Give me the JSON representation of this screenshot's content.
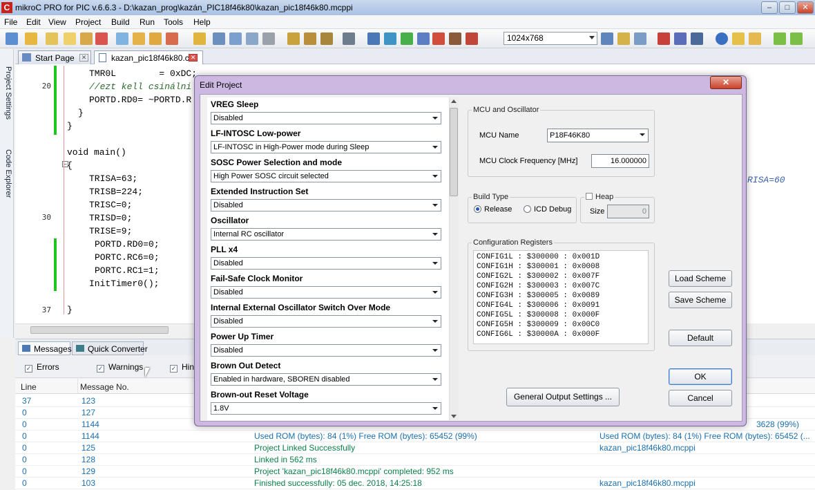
{
  "window": {
    "title": "mikroC PRO for PIC v.6.6.3 - D:\\kazan_prog\\kazán_PIC18f46k80\\kazan_pic18f46k80.mcppi",
    "app_icon": "C"
  },
  "menu": [
    "File",
    "Edit",
    "View",
    "Project",
    "Build",
    "Run",
    "Tools",
    "Help"
  ],
  "toolbar": {
    "resolution": "1024x768"
  },
  "side_tabs": [
    "Project Settings",
    "Code Explorer"
  ],
  "doc_tabs": [
    {
      "label": "Start Page"
    },
    {
      "label": "kazan_pic18f46k80.c"
    }
  ],
  "editor": {
    "line_numbers": [
      "20",
      "30",
      "37"
    ],
    "lines": [
      "TMR0L        = 0xDC;",
      "//ezt kell csinálni",
      "PORTD.RD0= ~PORTD.R",
      "}",
      "}",
      "void main()",
      "{",
      "TRISA=63;",
      "TRISB=224;",
      "TRISC=0;",
      "TRISD=0;",
      "TRISE=9;",
      "PORTD.RD0=0;",
      "PORTC.RC6=0;",
      "PORTC.RC1=1;",
      "InitTimer0();",
      "}"
    ],
    "right_fragment": "RISA=60"
  },
  "messages": {
    "tabs": [
      "Messages",
      "Quick Converter"
    ],
    "filters": [
      "Errors",
      "Warnings",
      "Hints"
    ],
    "columns": [
      "Line",
      "Message No."
    ],
    "rows": [
      {
        "line": "37",
        "no": "123",
        "text": "",
        "file": ""
      },
      {
        "line": "0",
        "no": "127",
        "text": "",
        "file": ""
      },
      {
        "line": "0",
        "no": "1144",
        "text": "",
        "file": "3628 (99%)"
      },
      {
        "line": "0",
        "no": "1144",
        "text": "Used ROM (bytes): 84 (1%)  Free ROM (bytes): 65452 (99%)",
        "file": "Used ROM (bytes): 84 (1%)  Free ROM (bytes): 65452 (..."
      },
      {
        "line": "0",
        "no": "125",
        "text": "Project Linked Successfully",
        "file": "kazan_pic18f46k80.mcppi"
      },
      {
        "line": "0",
        "no": "128",
        "text": "Linked in 562 ms",
        "file": ""
      },
      {
        "line": "0",
        "no": "129",
        "text": "Project 'kazan_pic18f46k80.mcppi' completed: 952 ms",
        "file": ""
      },
      {
        "line": "0",
        "no": "103",
        "text": "Finished successfully: 05 dec. 2018, 14:25:18",
        "file": "kazan_pic18f46k80.mcppi"
      }
    ]
  },
  "dialog": {
    "title": "Edit Project",
    "config_items": [
      {
        "label": "VREG Sleep",
        "value": "Disabled"
      },
      {
        "label": "LF-INTOSC Low-power",
        "value": "LF-INTOSC in High-Power mode during Sleep"
      },
      {
        "label": "SOSC Power Selection and mode",
        "value": "High Power SOSC circuit selected"
      },
      {
        "label": "Extended Instruction Set",
        "value": "Disabled"
      },
      {
        "label": "Oscillator",
        "value": "Internal RC oscillator"
      },
      {
        "label": "PLL x4",
        "value": "Disabled"
      },
      {
        "label": "Fail-Safe Clock Monitor",
        "value": "Disabled"
      },
      {
        "label": "Internal External Oscillator Switch Over Mode",
        "value": "Disabled"
      },
      {
        "label": "Power Up Timer",
        "value": "Disabled"
      },
      {
        "label": "Brown Out Detect",
        "value": "Enabled in hardware, SBOREN disabled"
      },
      {
        "label": "Brown-out Reset Voltage",
        "value": "1.8V"
      }
    ],
    "mcu_group": "MCU and Oscillator",
    "mcu_name_label": "MCU Name",
    "mcu_name": "P18F46K80",
    "mcu_clock_label": "MCU Clock Frequency [MHz]",
    "mcu_clock": "16.000000",
    "build_type_label": "Build Type",
    "release_label": "Release",
    "icd_label": "ICD Debug",
    "heap_label": "Heap",
    "size_label": "Size",
    "heap_size": "0",
    "config_regs_label": "Configuration Registers",
    "config_regs": [
      "CONFIG1L : $300000 : 0x001D",
      "CONFIG1H : $300001 : 0x0008",
      "CONFIG2L : $300002 : 0x007F",
      "CONFIG2H : $300003 : 0x007C",
      "CONFIG3H : $300005 : 0x0089",
      "CONFIG4L : $300006 : 0x0091",
      "CONFIG5L : $300008 : 0x000F",
      "CONFIG5H : $300009 : 0x00C0",
      "CONFIG6L : $30000A : 0x000F"
    ],
    "general_output_button": "General Output Settings ...",
    "load_scheme": "Load Scheme",
    "save_scheme": "Save Scheme",
    "default": "Default",
    "ok": "OK",
    "cancel": "Cancel"
  },
  "colors": {
    "accent": "#cdb8e2",
    "green_bar": "#21c521",
    "message_blue": "#1a6fb0"
  }
}
